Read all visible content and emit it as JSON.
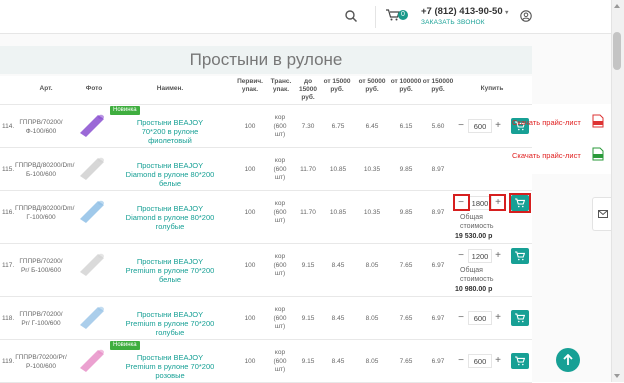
{
  "header": {
    "cart_count": "0",
    "phone": "+7 (812) 413-90-50",
    "phone_caret": "▾",
    "callback": "ЗАКАЗАТЬ ЗВОНОК"
  },
  "title": "Простыни в рулоне",
  "columns": {
    "art": "Арт.",
    "photo": "Фото",
    "name": "Наимен.",
    "pervich": "Первич. упак.",
    "trans": "Транс. упак.",
    "p1": "до 15000 руб.",
    "p2": "от 15000 руб.",
    "p3": "от 50000 руб.",
    "p4": "от 100000 руб.",
    "p5": "от 150000 руб.",
    "buy": "Купить"
  },
  "rows": [
    {
      "num": "114.",
      "art": "ГППРВ/70200/ Ф-100/600",
      "badge": "Новинка",
      "name": "Простыни BEAJOY 70*200 в рулоне фиолетовый",
      "pervich": "100",
      "trans": "кор (600 шт)",
      "p1": "7.30",
      "p2": "6.75",
      "p3": "6.45",
      "p4": "6.15",
      "p5": "5.60",
      "qty": "600",
      "color": "#8a4fd0"
    },
    {
      "num": "115.",
      "art": "ГППРВД/80200/Dm/ Б-100/600",
      "badge": "",
      "name": "Простыни BEAJOY Diamond в рулоне 80*200 белые",
      "pervich": "100",
      "trans": "кор (600 шт)",
      "p1": "11.70",
      "p2": "10.85",
      "p3": "10.35",
      "p4": "9.85",
      "p5": "8.97",
      "qty": "",
      "color": "#d0d0d0"
    },
    {
      "num": "116.",
      "art": "ГППРВД/80200/Dm/ Г-100/600",
      "badge": "",
      "name": "Простыни BEAJOY Diamond в рулоне 80*200 голубые",
      "pervich": "100",
      "trans": "кор (600 шт)",
      "p1": "11.70",
      "p2": "10.85",
      "p3": "10.35",
      "p4": "9.85",
      "p5": "8.97",
      "qty": "1800",
      "color": "#8fbfe6"
    },
    {
      "num": "117.",
      "art": "ГППРВ/70200/ Pr/ Б-100/600",
      "badge": "",
      "name": "Простыни BEAJOY Premium в рулоне 70*200 белые",
      "pervich": "100",
      "trans": "кор (600 шт)",
      "p1": "9.15",
      "p2": "8.45",
      "p3": "8.05",
      "p4": "7.65",
      "p5": "6.97",
      "qty": "1200",
      "color": "#d4d4d4"
    },
    {
      "num": "118.",
      "art": "ГППРВ/70200/ Pr/ Г-100/600",
      "badge": "",
      "name": "Простыни BEAJOY Premium в рулоне 70*200 голубые",
      "pervich": "100",
      "trans": "кор (600 шт)",
      "p1": "9.15",
      "p2": "8.45",
      "p3": "8.05",
      "p4": "7.65",
      "p5": "6.97",
      "qty": "600",
      "color": "#9cc6e8"
    },
    {
      "num": "119.",
      "art": "ГППРВ/70200/Pr/ Р-100/600",
      "badge": "Новинка",
      "name": "Простыни BEAJOY Premium в рулоне 70*200 розовые",
      "pervich": "100",
      "trans": "кор (600 шт)",
      "p1": "9.15",
      "p2": "8.45",
      "p3": "8.05",
      "p4": "7.65",
      "p5": "6.97",
      "qty": "600",
      "color": "#e890c8"
    }
  ],
  "totals": {
    "label": "Общая стоимость",
    "row116": "19 530.00 р",
    "row117": "10 980.00 р"
  },
  "side": {
    "download_pdf": "Скачать прайс-лист",
    "download_xls": "Скачать прайс-лист"
  },
  "glyphs": {
    "minus": "−",
    "plus": "+"
  },
  "colors": {
    "accent": "#17a095",
    "highlight": "#d61f1f",
    "badge": "#3fae3f"
  }
}
